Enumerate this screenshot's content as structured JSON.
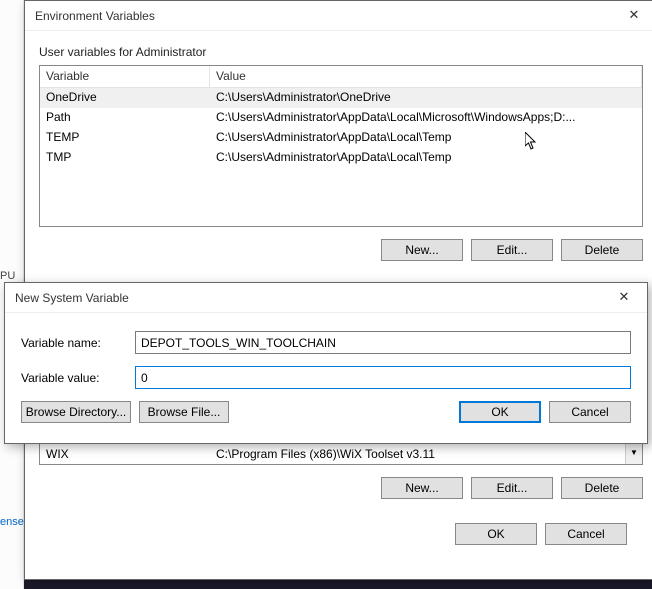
{
  "bgLeft": {
    "t1": "PU",
    "t2": "ense"
  },
  "envDialog": {
    "title": "Environment Variables",
    "userSection": {
      "label": "User variables for Administrator",
      "headers": {
        "variable": "Variable",
        "value": "Value"
      },
      "rows": [
        {
          "variable": "OneDrive",
          "value": "C:\\Users\\Administrator\\OneDrive",
          "selected": true
        },
        {
          "variable": "Path",
          "value": "C:\\Users\\Administrator\\AppData\\Local\\Microsoft\\WindowsApps;D:..."
        },
        {
          "variable": "TEMP",
          "value": "C:\\Users\\Administrator\\AppData\\Local\\Temp"
        },
        {
          "variable": "TMP",
          "value": "C:\\Users\\Administrator\\AppData\\Local\\Temp"
        }
      ],
      "buttons": {
        "new": "New...",
        "edit": "Edit...",
        "delete": "Delete"
      }
    },
    "systemSection": {
      "visibleRow": {
        "variable": "WIX",
        "value": "C:\\Program Files (x86)\\WiX Toolset v3.11"
      },
      "buttons": {
        "new": "New...",
        "edit": "Edit...",
        "delete": "Delete"
      }
    },
    "footer": {
      "ok": "OK",
      "cancel": "Cancel"
    }
  },
  "newDialog": {
    "title": "New System Variable",
    "nameLabel": "Variable name:",
    "nameValue": "DEPOT_TOOLS_WIN_TOOLCHAIN",
    "valueLabel": "Variable value:",
    "valueValue": "0",
    "browseDir": "Browse Directory...",
    "browseFile": "Browse File...",
    "ok": "OK",
    "cancel": "Cancel"
  }
}
